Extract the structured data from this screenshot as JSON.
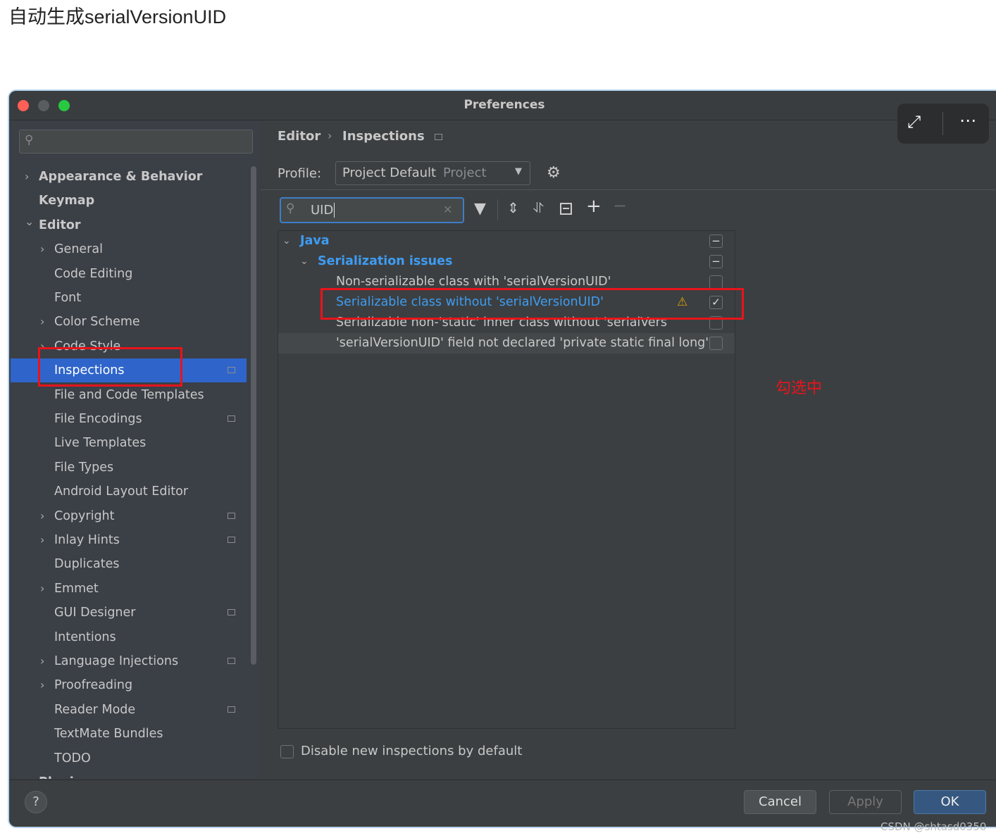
{
  "caption": "自动生成serialVersionUID",
  "window": {
    "title": "Preferences"
  },
  "sidebar": {
    "items": [
      {
        "label": "Appearance & Behavior",
        "level": 0,
        "chevron": ">",
        "bold": true
      },
      {
        "label": "Keymap",
        "level": 0,
        "bold": true
      },
      {
        "label": "Editor",
        "level": 0,
        "chevron": "v",
        "bold": true
      },
      {
        "label": "General",
        "level": 1,
        "chevron": ">"
      },
      {
        "label": "Code Editing",
        "level": 1
      },
      {
        "label": "Font",
        "level": 1
      },
      {
        "label": "Color Scheme",
        "level": 1,
        "chevron": ">"
      },
      {
        "label": "Code Style",
        "level": 1,
        "chevron": ">"
      },
      {
        "label": "Inspections",
        "level": 1,
        "selected": true,
        "project": true
      },
      {
        "label": "File and Code Templates",
        "level": 1
      },
      {
        "label": "File Encodings",
        "level": 1,
        "project": true
      },
      {
        "label": "Live Templates",
        "level": 1
      },
      {
        "label": "File Types",
        "level": 1
      },
      {
        "label": "Android Layout Editor",
        "level": 1
      },
      {
        "label": "Copyright",
        "level": 1,
        "chevron": ">",
        "project": true
      },
      {
        "label": "Inlay Hints",
        "level": 1,
        "chevron": ">",
        "project": true
      },
      {
        "label": "Duplicates",
        "level": 1
      },
      {
        "label": "Emmet",
        "level": 1,
        "chevron": ">"
      },
      {
        "label": "GUI Designer",
        "level": 1,
        "project": true
      },
      {
        "label": "Intentions",
        "level": 1
      },
      {
        "label": "Language Injections",
        "level": 1,
        "chevron": ">",
        "project": true
      },
      {
        "label": "Proofreading",
        "level": 1,
        "chevron": ">"
      },
      {
        "label": "Reader Mode",
        "level": 1,
        "project": true
      },
      {
        "label": "TextMate Bundles",
        "level": 1
      },
      {
        "label": "TODO",
        "level": 1
      },
      {
        "label": "Plugins",
        "level": 0,
        "bold": true,
        "project": true
      }
    ]
  },
  "breadcrumb": {
    "parent": "Editor",
    "current": "Inspections"
  },
  "profile": {
    "label": "Profile:",
    "value": "Project Default",
    "scope": "Project"
  },
  "search": {
    "value": "UID"
  },
  "tree": {
    "java": "Java",
    "group": "Serialization issues",
    "items": [
      {
        "label": "Non-serializable class with 'serialVersionUID'",
        "checked": false
      },
      {
        "label": "Serializable class without 'serialVersionUID'",
        "checked": true,
        "warning": true,
        "highlighted": true
      },
      {
        "label": "Serializable non-'static' inner class without 'serialVers",
        "checked": false
      },
      {
        "label": "'serialVersionUID' field not declared 'private static final long'",
        "checked": false
      }
    ]
  },
  "disable_new": {
    "label": "Disable new inspections by default",
    "checked": false
  },
  "annotation": "勾选中",
  "buttons": {
    "help": "?",
    "cancel": "Cancel",
    "apply": "Apply",
    "ok": "OK"
  },
  "watermark": "CSDN @shtasd0350",
  "colors": {
    "accent": "#2f65ca",
    "link": "#3e9cf2",
    "annotation": "#e8141b"
  }
}
